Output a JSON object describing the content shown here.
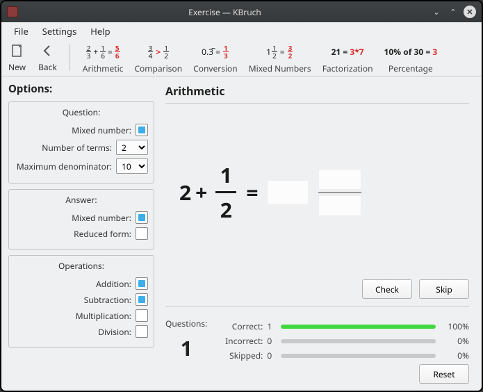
{
  "window": {
    "title": "Exercise — KBruch"
  },
  "menu": {
    "file": "File",
    "settings": "Settings",
    "help": "Help"
  },
  "toolbar": {
    "new_label": "New",
    "back_label": "Back"
  },
  "tabs": {
    "arithmetic": "Arithmetic",
    "comparison": "Comparison",
    "conversion": "Conversion",
    "mixed": "Mixed Numbers",
    "factor": "Factorization",
    "percent": "Percentage",
    "icons": {
      "arith": {
        "a_n": "2",
        "a_d": "3",
        "op": "+",
        "b_n": "1",
        "b_d": "6",
        "eq": "=",
        "r_n": "5",
        "r_d": "6"
      },
      "comp": {
        "a_n": "3",
        "a_d": "4",
        "op": ">",
        "b_n": "1",
        "b_d": "2"
      },
      "conv": {
        "lhs": "0.3̅",
        "eq": "=",
        "r_n": "1",
        "r_d": "3"
      },
      "mixed": {
        "whole": "1",
        "a_n": "1",
        "a_d": "2",
        "eq": "=",
        "r_n": "3",
        "r_d": "2"
      },
      "factor": {
        "lhs": "21 =",
        "rhs": "3*7"
      },
      "percent": {
        "lhs": "10% of 30 =",
        "rhs": "3"
      }
    }
  },
  "options": {
    "heading": "Options:",
    "question_title": "Question:",
    "mixed_number_label": "Mixed number:",
    "mixed_number_checked": true,
    "terms_label": "Number of terms:",
    "terms_value": "2",
    "denom_label": "Maximum denominator:",
    "denom_value": "10",
    "answer_title": "Answer:",
    "ans_mixed_label": "Mixed number:",
    "ans_mixed_checked": true,
    "reduced_label": "Reduced form:",
    "reduced_checked": false,
    "ops_title": "Operations:",
    "add_label": "Addition:",
    "add_checked": true,
    "sub_label": "Subtraction:",
    "sub_checked": true,
    "mul_label": "Multiplication:",
    "mul_checked": false,
    "div_label": "Division:",
    "div_checked": false
  },
  "exercise": {
    "heading": "Arithmetic",
    "whole": "2",
    "op": "+",
    "num": "1",
    "den": "2",
    "eq": "="
  },
  "actions": {
    "check": "Check",
    "skip": "Skip",
    "reset": "Reset"
  },
  "stats": {
    "questions_label": "Questions:",
    "questions_count": "1",
    "correct_label": "Correct:",
    "correct_val": "1",
    "correct_pct": "100%",
    "correct_fill": "100%",
    "correct_color": "#3fd83f",
    "incorrect_label": "Incorrect:",
    "incorrect_val": "0",
    "incorrect_pct": "0%",
    "incorrect_fill": "0%",
    "skipped_label": "Skipped:",
    "skipped_val": "0",
    "skipped_pct": "0%",
    "skipped_fill": "0%"
  }
}
